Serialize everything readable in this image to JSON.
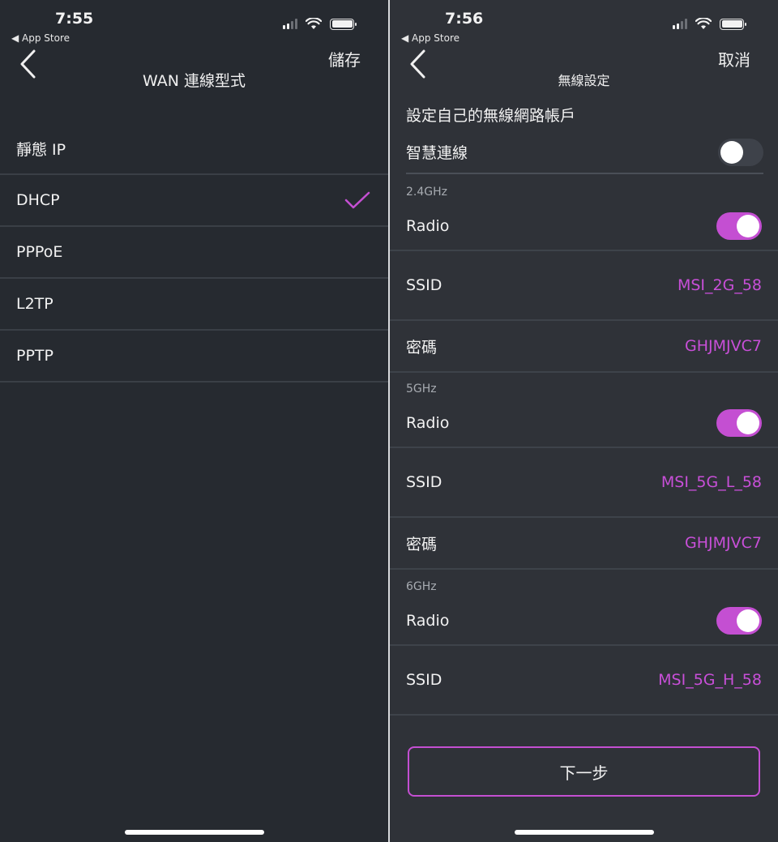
{
  "left": {
    "status": {
      "time": "7:55",
      "back_app": "◀ App Store"
    },
    "nav": {
      "title": "WAN 連線型式",
      "action": "儲存"
    },
    "options": [
      {
        "label": "靜態 IP",
        "selected": false
      },
      {
        "label": "DHCP",
        "selected": true
      },
      {
        "label": "PPPoE",
        "selected": false
      },
      {
        "label": "L2TP",
        "selected": false
      },
      {
        "label": "PPTP",
        "selected": false
      }
    ]
  },
  "right": {
    "status": {
      "time": "7:56",
      "back_app": "◀ App Store"
    },
    "nav": {
      "title": "無線設定",
      "action": "取消"
    },
    "section_title": "設定自己的無線網路帳戶",
    "smart_connect": {
      "label": "智慧連線",
      "on": false
    },
    "bands": [
      {
        "name": "2.4GHz",
        "radio_label": "Radio",
        "radio_on": true,
        "ssid_label": "SSID",
        "ssid": "MSI_2G_58",
        "password_label": "密碼",
        "password": "GHJMJVC7"
      },
      {
        "name": "5GHz",
        "radio_label": "Radio",
        "radio_on": true,
        "ssid_label": "SSID",
        "ssid": "MSI_5G_L_58",
        "password_label": "密碼",
        "password": "GHJMJVC7"
      },
      {
        "name": "6GHz",
        "radio_label": "Radio",
        "radio_on": true,
        "ssid_label": "SSID",
        "ssid": "MSI_5G_H_58"
      }
    ],
    "next_button": "下一步"
  },
  "colors": {
    "accent": "#c44fd2",
    "background": "#2b2e33",
    "text": "#f2f2f2"
  }
}
